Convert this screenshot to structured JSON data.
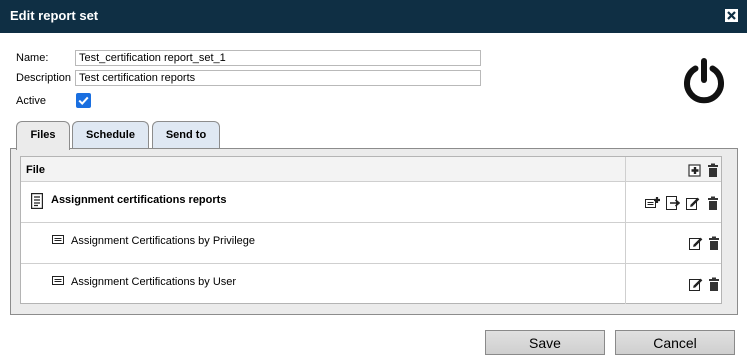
{
  "dialog": {
    "title": "Edit report set"
  },
  "form": {
    "name_label": "Name:",
    "name_value": "Test_certification report_set_1",
    "description_label": "Description",
    "description_value": "Test certification reports",
    "active_label": "Active",
    "active_checked": true
  },
  "tabs": [
    {
      "label": "Files",
      "active": true
    },
    {
      "label": "Schedule",
      "active": false
    },
    {
      "label": "Send to",
      "active": false
    }
  ],
  "table": {
    "header": "File",
    "rows": [
      {
        "label": "Assignment certifications reports",
        "type": "group",
        "icons": [
          "add-report-icon",
          "export-icon",
          "edit-icon",
          "delete-icon"
        ]
      },
      {
        "label": "Assignment Certifications by Privilege",
        "type": "report",
        "icons": [
          "edit-icon",
          "delete-icon"
        ]
      },
      {
        "label": "Assignment Certifications by User",
        "type": "report",
        "icons": [
          "edit-icon",
          "delete-icon"
        ]
      }
    ]
  },
  "buttons": {
    "save": "Save",
    "cancel": "Cancel"
  },
  "colors": {
    "titlebar": "#0f2f44",
    "checkbox": "#1a6fe0",
    "tab_inactive": "#dfe8f3",
    "panel": "#ebebeb"
  }
}
